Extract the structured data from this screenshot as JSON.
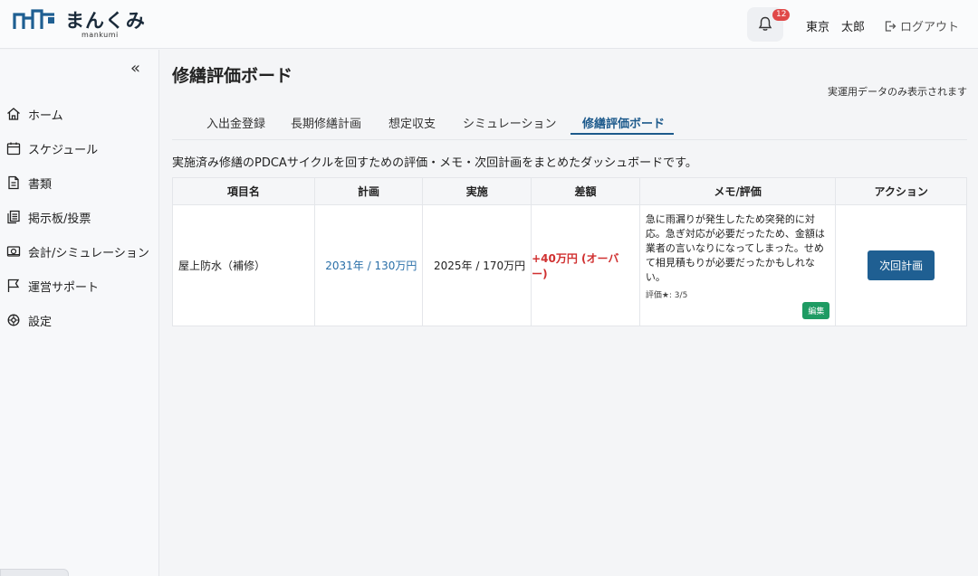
{
  "header": {
    "logo_text": "まんくみ",
    "logo_sub": "mankumi",
    "notification_count": "12",
    "user_name": "東京　太郎",
    "logout_label": "ログアウト"
  },
  "sidebar": {
    "items": [
      {
        "label": "ホーム",
        "icon": "home-icon"
      },
      {
        "label": "スケジュール",
        "icon": "calendar-icon"
      },
      {
        "label": "書類",
        "icon": "document-icon"
      },
      {
        "label": "掲示板/投票",
        "icon": "clipboard-icon"
      },
      {
        "label": "会計/シミュレーション",
        "icon": "money-icon"
      },
      {
        "label": "運営サポート",
        "icon": "flag-icon"
      },
      {
        "label": "設定",
        "icon": "gear-icon"
      }
    ]
  },
  "main": {
    "title": "修繕評価ボード",
    "note": "実運用データのみ表示されます",
    "tabs": [
      {
        "label": "入出金登録"
      },
      {
        "label": "長期修繕計画"
      },
      {
        "label": "想定収支"
      },
      {
        "label": "シミュレーション"
      },
      {
        "label": "修繕評価ボード"
      }
    ],
    "active_tab": "修繕評価ボード",
    "description": "実施済み修繕のPDCAサイクルを回すための評価・メモ・次回計画をまとめたダッシュボードです。"
  },
  "table": {
    "headers": [
      "項目名",
      "計画",
      "実施",
      "差額",
      "メモ/評価",
      "アクション"
    ],
    "rows": [
      {
        "item": "屋上防水（補修）",
        "plan": "2031年 / 130万円",
        "actual": "2025年 / 170万円",
        "diff": "+40万円 (オーバー)",
        "memo": "急に雨漏りが発生したため突発的に対応。急ぎ対応が必要だったため、金額は業者の言いなりになってしまった。せめて相見積もりが必要だったかもしれない。",
        "rating": "評価★: 3/5",
        "edit_label": "編集",
        "action_label": "次回計画"
      }
    ]
  },
  "colors": {
    "accent": "#1d5a8c",
    "diff_over": "#d03030",
    "edit_green": "#1e9b63",
    "badge_red": "#e04848"
  }
}
